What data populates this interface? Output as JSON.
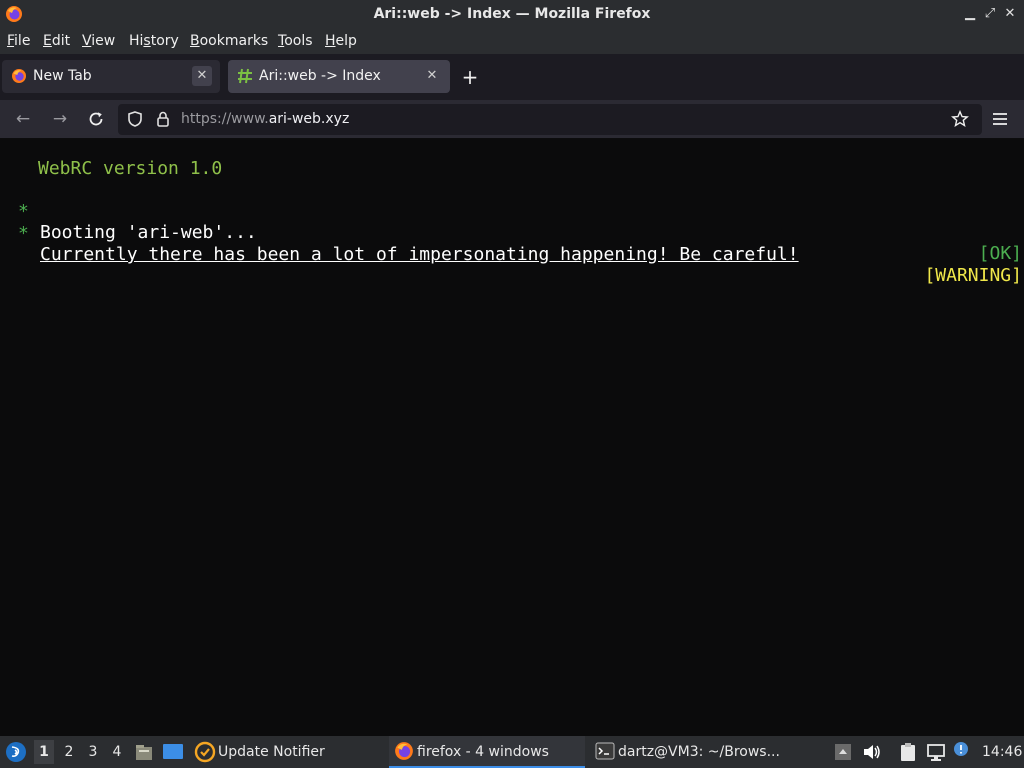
{
  "window": {
    "title": "Ari::web -> Index — Mozilla Firefox",
    "minimize_glyph": "▁",
    "maximize_glyph": "⤢",
    "close_glyph": "✕"
  },
  "menubar": {
    "items": [
      {
        "pre": "",
        "accel": "F",
        "post": "ile"
      },
      {
        "pre": "",
        "accel": "E",
        "post": "dit"
      },
      {
        "pre": "",
        "accel": "V",
        "post": "iew"
      },
      {
        "pre": "Hi",
        "accel": "s",
        "post": "tory"
      },
      {
        "pre": "",
        "accel": "B",
        "post": "ookmarks"
      },
      {
        "pre": "",
        "accel": "T",
        "post": "ools"
      },
      {
        "pre": "",
        "accel": "H",
        "post": "elp"
      }
    ]
  },
  "tabs": [
    {
      "label": "New Tab",
      "icon": "firefox-icon",
      "close": "✕"
    },
    {
      "label": "Ari::web -> Index",
      "icon": "hash-icon",
      "close": "✕"
    }
  ],
  "new_tab_glyph": "+",
  "nav": {
    "back_glyph": "←",
    "forward_glyph": "→",
    "url_prefix": "https://www.",
    "url_domain": "ari-web.xyz"
  },
  "content": {
    "header": "WebRC version 1.0",
    "lines": [
      {
        "bullet": "*",
        "text": "Booting 'ari-web'...",
        "status": "[OK]"
      },
      {
        "bullet": "*",
        "text": "Currently there has been a lot of impersonating happening! Be careful!",
        "status": "[WARNING]"
      }
    ],
    "colors": {
      "bullet": "#4caf50",
      "header": "#8fc04a",
      "ok": "#4caf50",
      "warning": "#f0e84a"
    }
  },
  "taskbar": {
    "workspaces": [
      "1",
      "2",
      "3",
      "4"
    ],
    "tasks": [
      {
        "label": "Update Notifier",
        "icon": "update-notifier-icon"
      },
      {
        "label": "firefox - 4 windows",
        "icon": "firefox-icon"
      },
      {
        "label": "dartz@VM3: ~/Brows...",
        "icon": "terminal-icon"
      }
    ],
    "clock": "14:46"
  }
}
